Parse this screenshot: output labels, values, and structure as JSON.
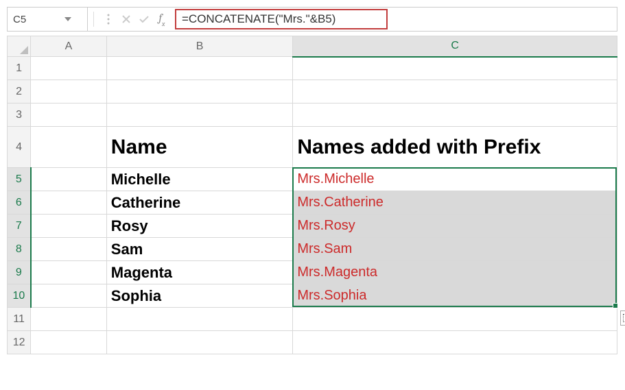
{
  "nameBox": {
    "value": "C5"
  },
  "formulaBar": {
    "value": "=CONCATENATE(\"Mrs.\"&B5)"
  },
  "columns": [
    "A",
    "B",
    "C"
  ],
  "selectedColumn": "C",
  "rows": [
    1,
    2,
    3,
    4,
    5,
    6,
    7,
    8,
    9,
    10,
    11,
    12
  ],
  "selectedRows": [
    5,
    6,
    7,
    8,
    9,
    10
  ],
  "headers": {
    "B4": "Name",
    "C4": "Names added with Prefix"
  },
  "names": [
    "Michelle",
    "Catherine",
    "Rosy",
    "Sam",
    "Magenta",
    "Sophia"
  ],
  "prefixed": [
    "Mrs.Michelle",
    "Mrs.Catherine",
    "Mrs.Rosy",
    "Mrs.Sam",
    "Mrs.Magenta",
    "Mrs.Sophia"
  ],
  "chart_data": {
    "type": "table",
    "columns": [
      "Name",
      "Names added with Prefix"
    ],
    "rows": [
      [
        "Michelle",
        "Mrs.Michelle"
      ],
      [
        "Catherine",
        "Mrs.Catherine"
      ],
      [
        "Rosy",
        "Mrs.Rosy"
      ],
      [
        "Sam",
        "Mrs.Sam"
      ],
      [
        "Magenta",
        "Mrs.Magenta"
      ],
      [
        "Sophia",
        "Mrs.Sophia"
      ]
    ]
  }
}
